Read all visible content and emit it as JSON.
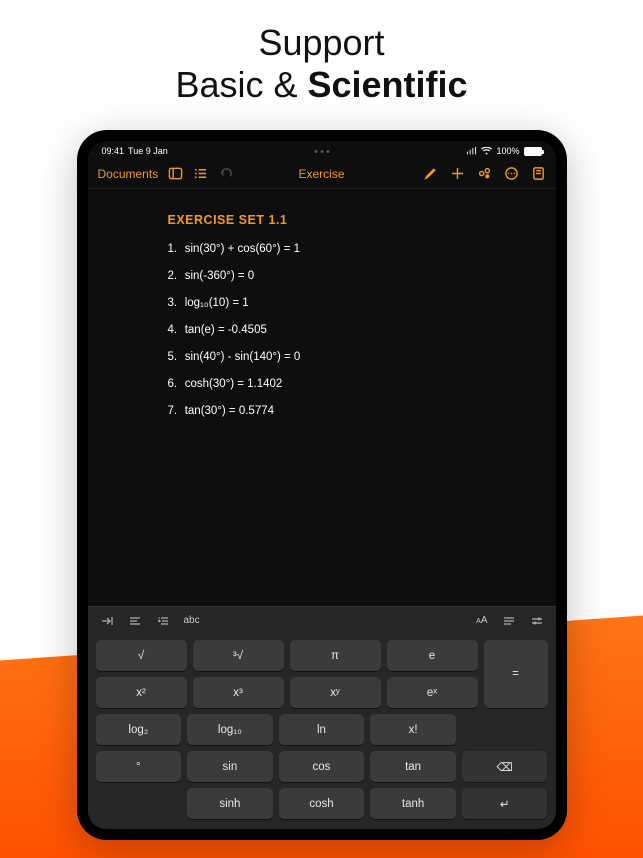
{
  "headline": {
    "line1": "Support",
    "line2_a": "Basic & ",
    "line2_b": "Scientific"
  },
  "statusbar": {
    "time": "09:41",
    "date": "Tue 9 Jan",
    "battery": "100%"
  },
  "toolbar": {
    "back": "Documents",
    "title": "Exercise"
  },
  "doc": {
    "heading": "EXERCISE SET 1.1",
    "lines": [
      "sin(30°) + cos(60°) = 1",
      "sin(-360°) = 0",
      "log₁₀(10) = 1",
      "tan(e) = -0.4505",
      "sin(40°) - sin(140°) = 0",
      "cosh(30°) = 1.1402",
      "tan(30°) = 0.5774"
    ]
  },
  "kbtool": {
    "abc": "abc",
    "aa": "AA"
  },
  "keys": {
    "r1": [
      "√",
      "³√",
      "π",
      "e"
    ],
    "r2": [
      "x²",
      "x³",
      "xʸ",
      "eˣ"
    ],
    "r3": [
      "log₂",
      "log₁₀",
      "ln",
      "x!"
    ],
    "r4": [
      "°",
      "sin",
      "cos",
      "tan",
      "⌫"
    ],
    "r5": [
      "",
      "sinh",
      "cosh",
      "tanh",
      "↵"
    ],
    "equals": "="
  }
}
